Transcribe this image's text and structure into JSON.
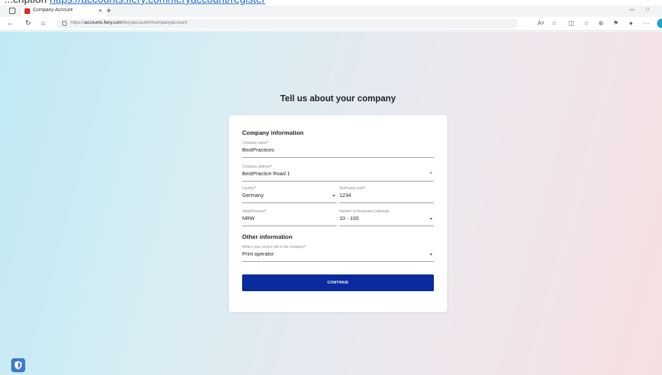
{
  "top_strip": {
    "prefix": "...cription",
    "link": "https://accounts.fiery.com/fieryaccount/register"
  },
  "browser": {
    "tab_title": "Company Account",
    "tab_close": "×",
    "new_tab": "+",
    "win_min": "–",
    "win_max": "□",
    "url_prefix": "https://",
    "url_host": "accounts.fiery.com",
    "url_path": "/fieryaccount/#/companyaccount",
    "icons": [
      "tab-actions-icon",
      "back-icon",
      "refresh-icon",
      "home-icon",
      "lock-icon",
      "read-aloud-icon",
      "favorite-icon",
      "split-screen-icon",
      "favorites-bar-icon",
      "collections-icon",
      "extension-icon",
      "profile-icon",
      "more-icon"
    ]
  },
  "page": {
    "heading": "Tell us about your company",
    "company_section": "Company information",
    "fields": {
      "company_name": {
        "label": "Company name",
        "value": "BestPractices"
      },
      "company_address": {
        "label": "Company address",
        "value": "BestPractice Road 1"
      },
      "country": {
        "label": "Country",
        "value": "Germany"
      },
      "zip": {
        "label": "Zip/Postal code",
        "value": "1234"
      },
      "state": {
        "label": "State/Province",
        "value": "NRW"
      },
      "employees": {
        "label": "Number of employees (optional)",
        "value": "10 - 100"
      },
      "role": {
        "label": "What's your current role in the company?",
        "value": "Print operator"
      }
    },
    "required_mark": "*",
    "clear_symbol": "×",
    "other_section": "Other information",
    "continue_label": "CONTINUE"
  },
  "colors": {
    "button": "#0a2b9e",
    "required": "#e02020",
    "favicon": "#d92b2b",
    "shield": "#3d7ad0"
  }
}
